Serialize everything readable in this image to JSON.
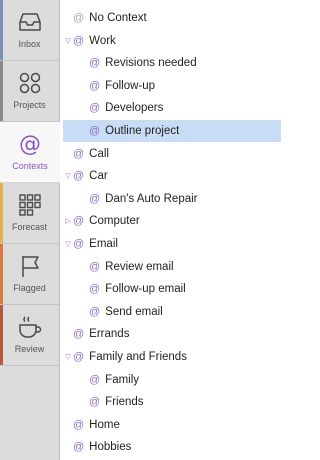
{
  "sidebar": {
    "tabs": [
      {
        "label": "Inbox",
        "icon": "inbox-icon",
        "accent": "#7a8fb7"
      },
      {
        "label": "Projects",
        "icon": "projects-icon",
        "accent": "#8a8a8a"
      },
      {
        "label": "Contexts",
        "icon": "contexts-icon",
        "accent": "#8b55c7"
      },
      {
        "label": "Forecast",
        "icon": "forecast-icon",
        "accent": "#e3b04b"
      },
      {
        "label": "Flagged",
        "icon": "flag-icon",
        "accent": "#e0773a"
      },
      {
        "label": "Review",
        "icon": "review-icon",
        "accent": "#b7593a"
      }
    ]
  },
  "contexts": [
    {
      "label": "No Context",
      "level": 0,
      "expanded": null,
      "dim": true,
      "selected": false
    },
    {
      "label": "Work",
      "level": 0,
      "expanded": true,
      "dim": false,
      "selected": false
    },
    {
      "label": "Revisions needed",
      "level": 1,
      "expanded": null,
      "dim": false,
      "selected": false
    },
    {
      "label": "Follow-up",
      "level": 1,
      "expanded": null,
      "dim": false,
      "selected": false
    },
    {
      "label": "Developers",
      "level": 1,
      "expanded": null,
      "dim": false,
      "selected": false
    },
    {
      "label": "Outline project",
      "level": 1,
      "expanded": null,
      "dim": false,
      "selected": true
    },
    {
      "label": "Call",
      "level": 0,
      "expanded": null,
      "dim": false,
      "selected": false
    },
    {
      "label": "Car",
      "level": 0,
      "expanded": true,
      "dim": false,
      "selected": false
    },
    {
      "label": "Dan's Auto Repair",
      "level": 1,
      "expanded": null,
      "dim": false,
      "selected": false
    },
    {
      "label": "Computer",
      "level": 0,
      "expanded": false,
      "dim": false,
      "selected": false
    },
    {
      "label": "Email",
      "level": 0,
      "expanded": true,
      "dim": false,
      "selected": false
    },
    {
      "label": "Review email",
      "level": 1,
      "expanded": null,
      "dim": false,
      "selected": false
    },
    {
      "label": "Follow-up email",
      "level": 1,
      "expanded": null,
      "dim": false,
      "selected": false
    },
    {
      "label": "Send email",
      "level": 1,
      "expanded": null,
      "dim": false,
      "selected": false
    },
    {
      "label": "Errands",
      "level": 0,
      "expanded": null,
      "dim": false,
      "selected": false
    },
    {
      "label": "Family and Friends",
      "level": 0,
      "expanded": true,
      "dim": false,
      "selected": false
    },
    {
      "label": "Family",
      "level": 1,
      "expanded": null,
      "dim": false,
      "selected": false
    },
    {
      "label": "Friends",
      "level": 1,
      "expanded": null,
      "dim": false,
      "selected": false
    },
    {
      "label": "Home",
      "level": 0,
      "expanded": null,
      "dim": false,
      "selected": false
    },
    {
      "label": "Hobbies",
      "level": 0,
      "expanded": null,
      "dim": false,
      "selected": false
    }
  ]
}
